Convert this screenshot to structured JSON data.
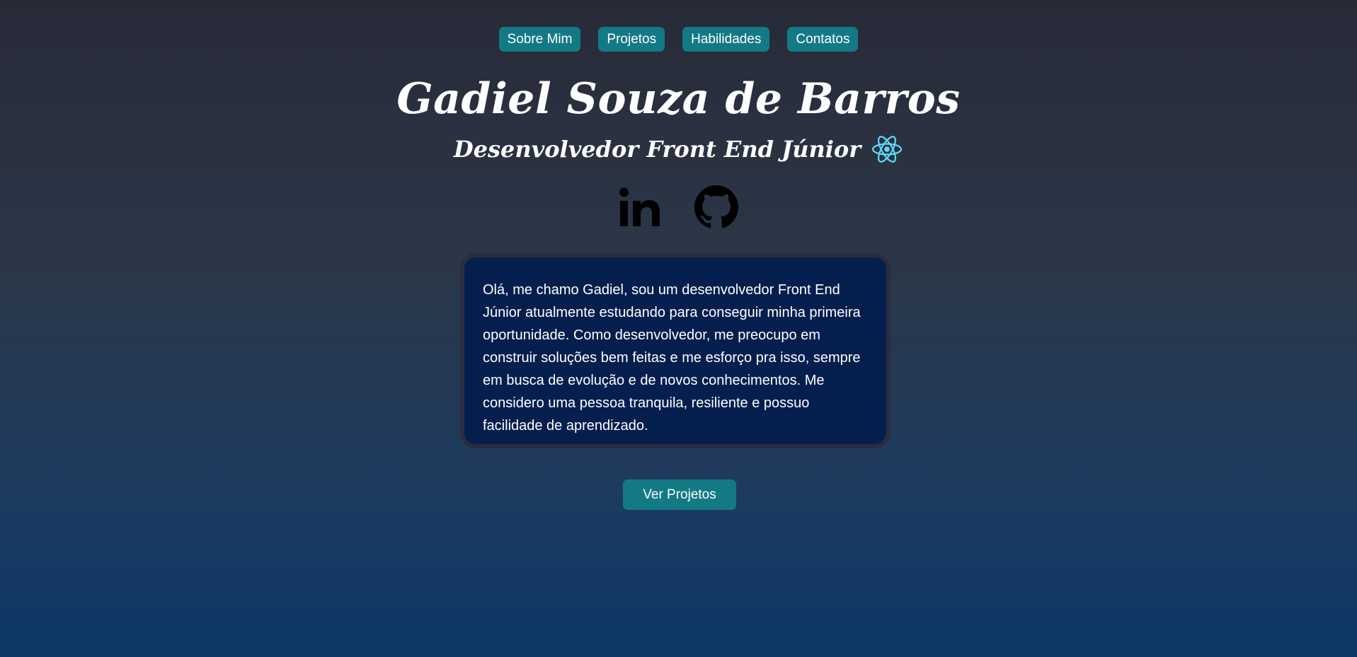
{
  "nav": {
    "items": [
      {
        "label": "Sobre Mim"
      },
      {
        "label": "Projetos"
      },
      {
        "label": "Habilidades"
      },
      {
        "label": "Contatos"
      }
    ]
  },
  "hero": {
    "name": "Gadiel Souza de Barros",
    "subtitle": "Desenvolvedor Front End Júnior",
    "subtitle_icon": "react-icon"
  },
  "socials": [
    {
      "icon": "linkedin-icon"
    },
    {
      "icon": "github-icon"
    }
  ],
  "about": {
    "text": "Olá, me chamo Gadiel, sou um desenvolvedor Front End Júnior atualmente estudando para conseguir minha primeira oportunidade. Como desenvolvedor, me preocupo em construir soluções bem feitas e me esforço pra isso, sempre em busca de evolução e de novos conhecimentos. Me considero uma pessoa tranquila, resiliente e possuo facilidade de aprendizado."
  },
  "cta": {
    "label": "Ver Projetos"
  },
  "colors": {
    "accent": "#137a85",
    "card_bg": "#041f4e",
    "card_border": "#2a2c40",
    "react": "#61dafb"
  }
}
